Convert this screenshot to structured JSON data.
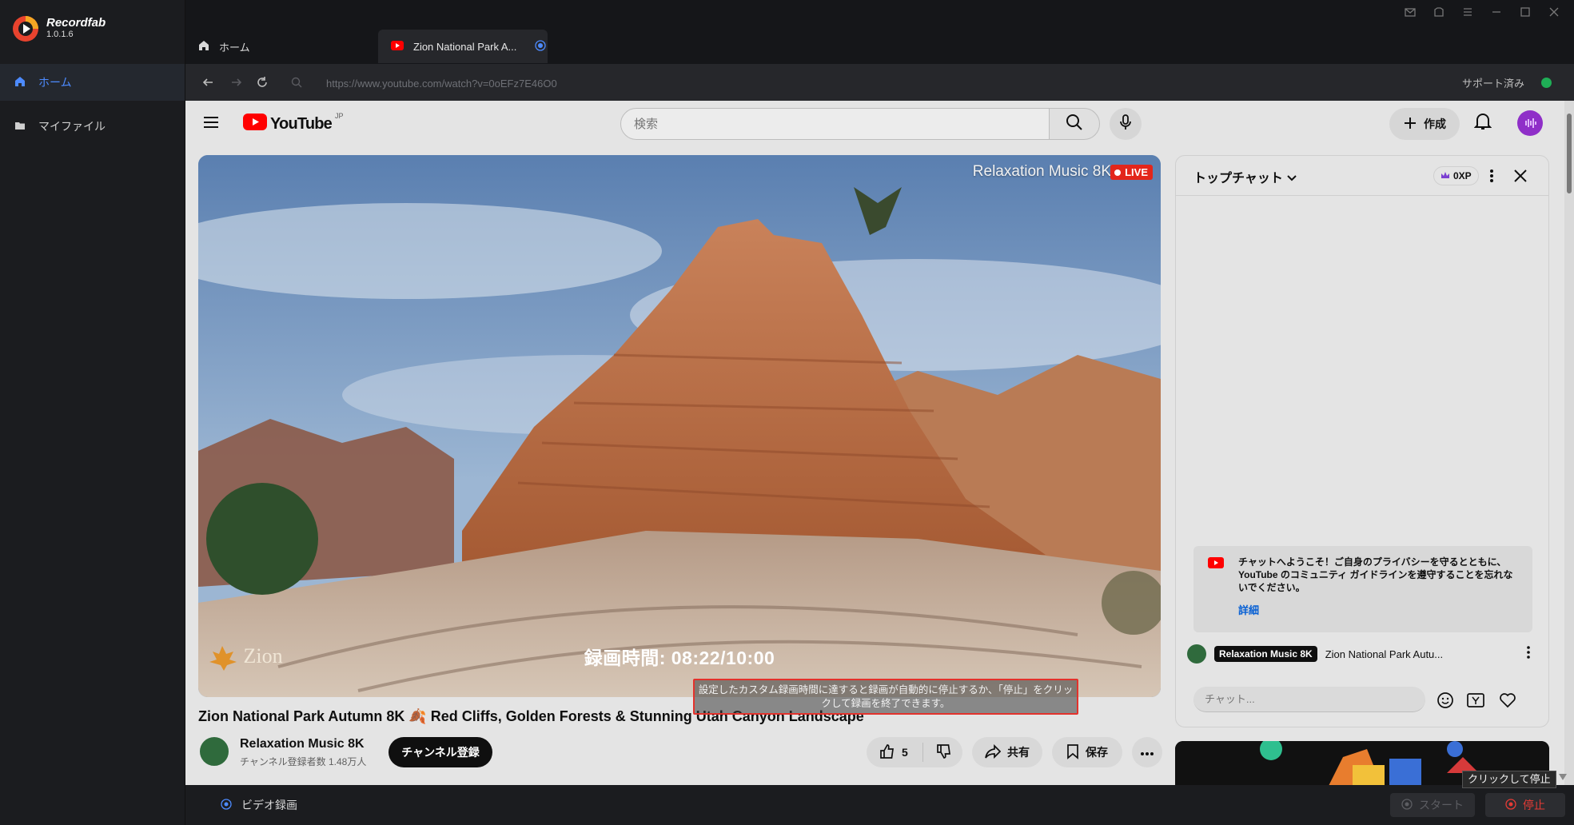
{
  "app": {
    "name": "Recordfab",
    "version": "1.0.1.6"
  },
  "sidebar": {
    "items": [
      {
        "label": "ホーム",
        "icon": "home-icon"
      },
      {
        "label": "マイファイル",
        "icon": "folder-icon"
      }
    ]
  },
  "tabs": [
    {
      "label": "ホーム",
      "icon": "home-icon"
    },
    {
      "label": "Zion National Park A...",
      "icon": "youtube-icon"
    }
  ],
  "address": {
    "url": "https://www.youtube.com/watch?v=0oEFz7E46O0",
    "support_status": "サポート済み",
    "support_color": "#1fae56"
  },
  "youtube": {
    "logo_text": "YouTube",
    "region": "JP",
    "search_placeholder": "検索",
    "create_label": "作成"
  },
  "player": {
    "channel_overlay": "Relaxation Music 8K",
    "live_label": "LIVE",
    "brand_watermark": "Zion",
    "recording_time": "録画時間: 08:22/10:00",
    "recording_note": "設定したカスタム録画時間に達すると録画が自動的に停止するか、「停止」をクリックして録画を終了できます。"
  },
  "video": {
    "title": "Zion National Park Autumn 8K 🍂 Red Cliffs, Golden Forests & Stunning Utah Canyon Landscape",
    "channel": "Relaxation Music 8K",
    "subscribers": "チャンネル登録者数 1.48万人",
    "subscribe_label": "チャンネル登録",
    "like_count": "5",
    "share_label": "共有",
    "save_label": "保存"
  },
  "chat": {
    "title": "トップチャット",
    "xp": "0XP",
    "welcome_text": "チャットへようこそ！ご自身のプライバシーを守るとともに、YouTube のコミュニティ ガイドラインを遵守することを忘れないでください。",
    "welcome_more": "詳細",
    "pinned_channel": "Relaxation Music 8K",
    "pinned_text": "Zion National Park Autu...",
    "input_placeholder": "チャット..."
  },
  "bottom": {
    "mode_label": "ビデオ録画",
    "start_label": "スタート",
    "stop_label": "停止",
    "stop_tooltip": "クリックして停止"
  }
}
